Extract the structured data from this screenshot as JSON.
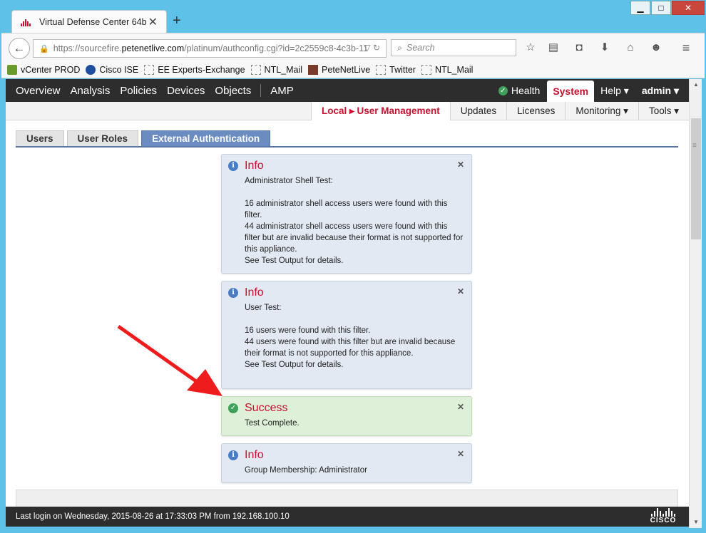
{
  "browser": {
    "tab_title": "Virtual Defense Center 64b...",
    "url_prefix": "https://sourcefire.",
    "url_host": "petenetlive.com",
    "url_rest": "/platinum/authconfig.cgi?id=2c2559c8-4c3b-11",
    "search_placeholder": "Search",
    "bookmarks": [
      {
        "label": "vCenter PROD",
        "icon": "vcenter-icon"
      },
      {
        "label": "Cisco ISE",
        "icon": "cisco-ise-icon"
      },
      {
        "label": "EE Experts-Exchange",
        "icon": "page-icon"
      },
      {
        "label": "NTL_Mail",
        "icon": "page-icon"
      },
      {
        "label": "PeteNetLive",
        "icon": "petenetlive-icon"
      },
      {
        "label": "Twitter",
        "icon": "page-icon"
      },
      {
        "label": "NTL_Mail",
        "icon": "page-icon"
      }
    ]
  },
  "topnav": {
    "items": [
      "Overview",
      "Analysis",
      "Policies",
      "Devices",
      "Objects",
      "AMP"
    ],
    "health": "Health",
    "system": "System",
    "help": "Help ▾",
    "admin": "admin ▾"
  },
  "subnav": {
    "local_prefix": "Local ▸ ",
    "local_active": "User Management",
    "items": [
      "Updates",
      "Licenses",
      "Monitoring ▾",
      "Tools ▾"
    ]
  },
  "page_tabs": [
    "Users",
    "User Roles",
    "External Authentication"
  ],
  "messages": [
    {
      "type": "info",
      "title": "Info",
      "body": "Administrator Shell Test:\n\n16 administrator shell access users were found with this filter.\n44 administrator shell access users were found with this filter but are invalid because their format is not supported for this appliance.\nSee Test Output for details."
    },
    {
      "type": "info",
      "title": "Info",
      "body": "User Test:\n\n16 users were found with this filter.\n44 users were found with this filter but are invalid because their format is not supported for this appliance.\nSee Test Output for details."
    },
    {
      "type": "success",
      "title": "Success",
      "body": "Test Complete."
    },
    {
      "type": "info",
      "title": "Info",
      "body": "Group Membership: Administrator"
    }
  ],
  "footer": {
    "last_login": "Last login on Wednesday, 2015-08-26 at 17:33:03 PM from 192.168.100.10",
    "logo_text": "CISCO"
  },
  "colors": {
    "accent_red": "#c8102e",
    "nav_dark": "#2d2d2d",
    "tab_blue": "#6b8cc0",
    "window_blue": "#5ec2e8"
  }
}
